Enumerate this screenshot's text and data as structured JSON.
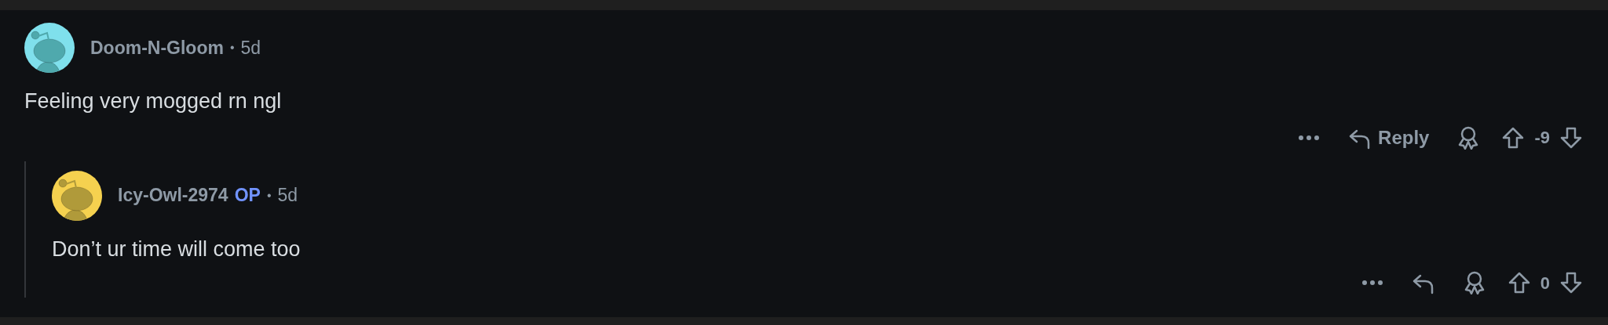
{
  "comments": [
    {
      "author": "Doom-N-Gloom",
      "op": false,
      "separator": "•",
      "time": "5d",
      "body": "Feeling very mogged rn ngl",
      "reply_label": "Reply",
      "score": "-9",
      "color": "#7fe0ec",
      "nested": false
    },
    {
      "author": "Icy-Owl-2974",
      "op": true,
      "op_label": "OP",
      "separator": "•",
      "time": "5d",
      "body": "Don’t ur time will come too",
      "score": "0",
      "color": "#f5d14f",
      "nested": true
    }
  ]
}
